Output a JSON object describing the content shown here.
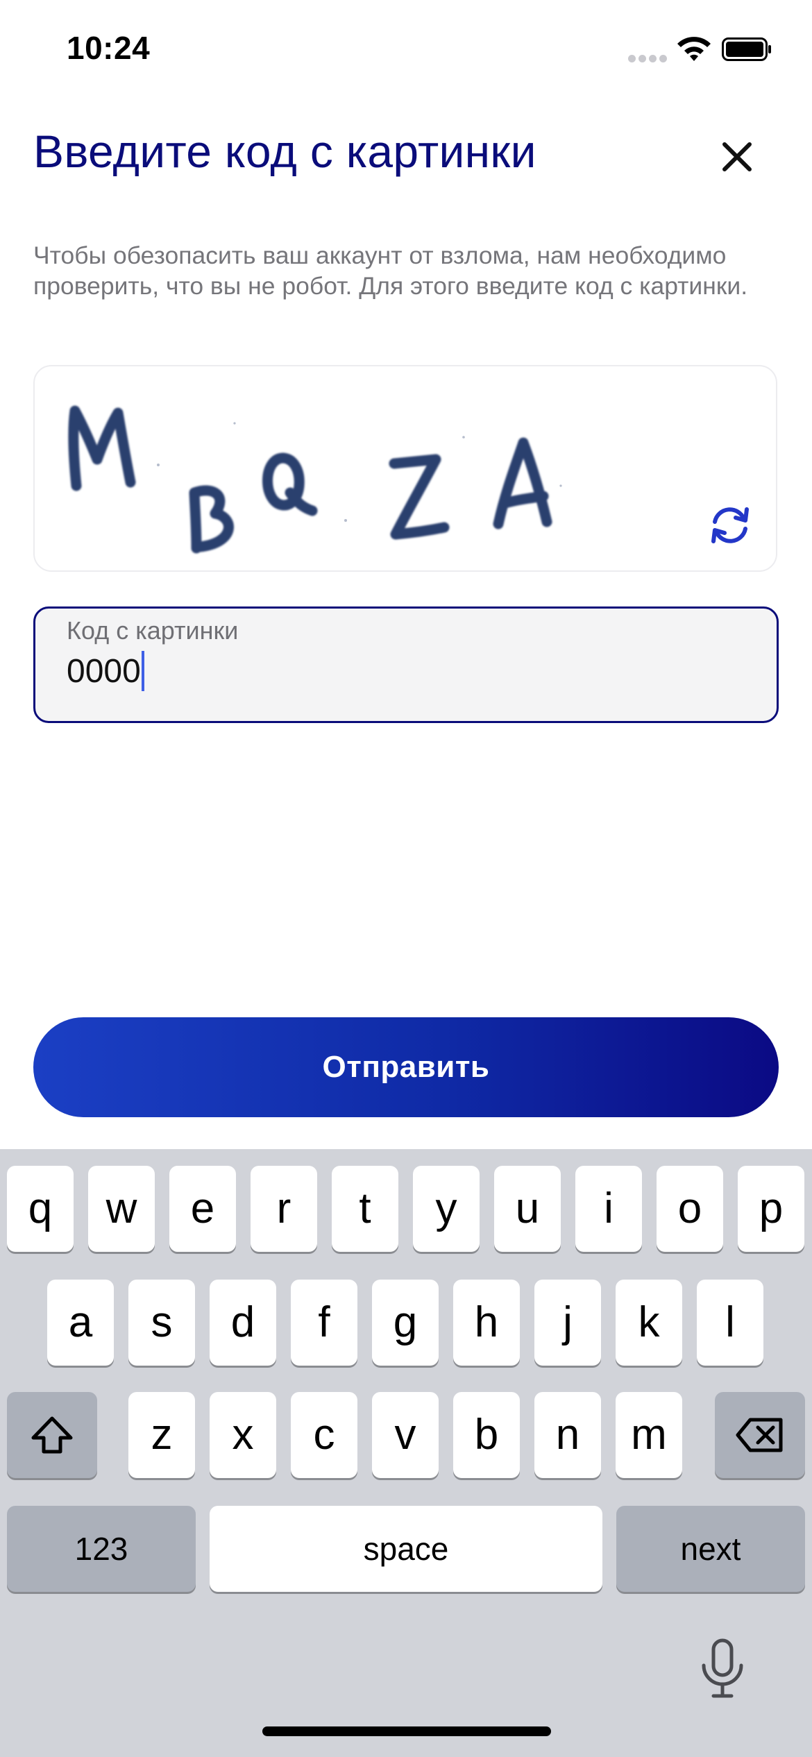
{
  "status_bar": {
    "time": "10:24"
  },
  "header": {
    "title": "Введите код с картинки"
  },
  "description": "Чтобы обезопасить ваш аккаунт от взлома, нам необходимо проверить, что вы не робот. Для этого введите код с картинки.",
  "captcha": {
    "letters": [
      "M",
      "B",
      "Q",
      "Z",
      "A"
    ]
  },
  "input": {
    "label": "Код с картинки",
    "value": "0000"
  },
  "submit": {
    "label": "Отправить"
  },
  "keyboard": {
    "row1": [
      "q",
      "w",
      "e",
      "r",
      "t",
      "y",
      "u",
      "i",
      "o",
      "p"
    ],
    "row2": [
      "a",
      "s",
      "d",
      "f",
      "g",
      "h",
      "j",
      "k",
      "l"
    ],
    "row3": [
      "z",
      "x",
      "c",
      "v",
      "b",
      "n",
      "m"
    ],
    "numbers_label": "123",
    "space_label": "space",
    "next_label": "next"
  },
  "colors": {
    "accent": "#0a0c7a",
    "button_start": "#1b3fc4",
    "button_end": "#0b0a84",
    "caret": "#3f5fe6"
  },
  "icons": [
    "close-icon",
    "refresh-icon",
    "shift-icon",
    "backspace-icon",
    "microphone-icon",
    "wifi-icon",
    "battery-icon",
    "signal-icon"
  ]
}
